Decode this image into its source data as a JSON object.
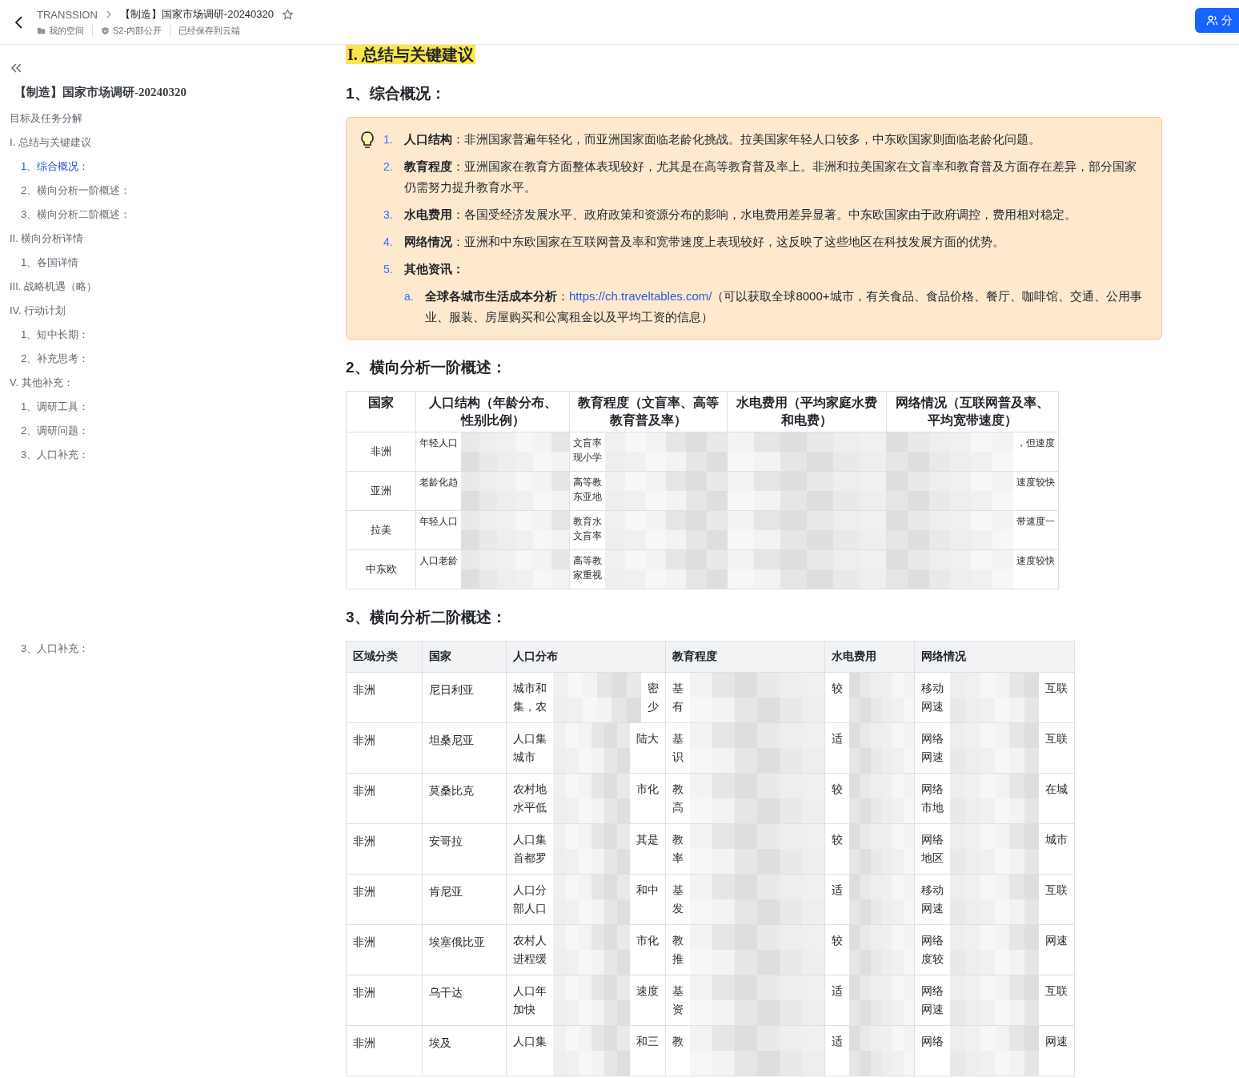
{
  "header": {
    "breadcrumb": "TRANSSION",
    "title": "【制造】国家市场调研-20240320",
    "starred": false,
    "meta": [
      {
        "kind": "folder",
        "text": "我的空间"
      },
      {
        "kind": "shield",
        "text": "S2-内部公开"
      },
      {
        "kind": "plain",
        "text": "已经保存到云端"
      }
    ],
    "share_button": "分"
  },
  "sidebar": {
    "title": "【制造】国家市场调研-20240320",
    "items": [
      {
        "label": "目标及任务分解",
        "selected": false
      },
      {
        "label": "I. 总结与关键建议",
        "selected": false,
        "children": [
          {
            "label": "1、综合概况：",
            "selected": true
          },
          {
            "label": "2、横向分析一阶概述：",
            "selected": false
          },
          {
            "label": "3、横向分析二阶概述：",
            "selected": false
          }
        ]
      },
      {
        "label": "II. 横向分析详情",
        "selected": false,
        "children": [
          {
            "label": "1、各国详情",
            "selected": false
          }
        ]
      },
      {
        "label": "III. 战略机遇（略）",
        "selected": false
      },
      {
        "label": "IV. 行动计划",
        "selected": false,
        "children": [
          {
            "label": "1、短中长期：",
            "selected": false
          },
          {
            "label": "2、补充思考：",
            "selected": false
          }
        ]
      },
      {
        "label": "V. 其他补充：",
        "selected": false,
        "children": [
          {
            "label": "1、调研工具：",
            "selected": false
          },
          {
            "label": "2、调研问题：",
            "selected": false
          },
          {
            "label": "3、人口补充：",
            "selected": false
          }
        ]
      }
    ],
    "trailing_text": "3、人口补充："
  },
  "document": {
    "section_title": "I. 总结与关键建议",
    "blocks": [
      {
        "kind": "heading",
        "text": "1、综合概况："
      },
      {
        "kind": "callout",
        "items": [
          {
            "marker": "1.",
            "term": "人口结构",
            "text": "：非洲国家普遍年轻化，而亚洲国家面临老龄化挑战。拉美国家年轻人口较多，中东欧国家则面临老龄化问题。"
          },
          {
            "marker": "2.",
            "term": "教育程度",
            "text": "：亚洲国家在教育方面整体表现较好，尤其是在高等教育普及率上。非洲和拉美国家在文盲率和教育普及方面存在差异，部分国家仍需努力提升教育水平。"
          },
          {
            "marker": "3.",
            "term": "水电费用",
            "text": "：各国受经济发展水平、政府政策和资源分布的影响，水电费用差异显著。中东欧国家由于政府调控，费用相对稳定。"
          },
          {
            "marker": "4.",
            "term": "网络情况",
            "text": "：亚洲和中东欧国家在互联网普及率和宽带速度上表现较好，这反映了这些地区在科技发展方面的优势。"
          },
          {
            "marker": "5.",
            "term": "其他资讯：",
            "children": [
              {
                "marker": "a.",
                "term": "全球各城市生活成本分析",
                "text": "：",
                "link": "https://ch.traveltables.com/",
                "after": "（可以获取全球8000+城市，有关食品、食品价格、餐厅、咖啡馆、交通、公用事业、服装、房屋购买和公寓租金以及平均工资的信息）"
              }
            ]
          }
        ]
      },
      {
        "kind": "heading",
        "text": "2、横向分析一阶概述："
      },
      {
        "kind": "summary_table",
        "columns": [
          "国家",
          "人口结构（年龄分布、性别比例）",
          "教育程度（文盲率、高等教育普及率）",
          "水电费用（平均家庭水费和电费）",
          "网络情况（互联网普及率、平均宽带速度）"
        ],
        "rows": [
          {
            "cells": [
              "非洲",
              {
                "left": [
                  "年轻人口"
                ],
                "redacted": true
              },
              {
                "left": [
                  "文盲率",
                  "现小学"
                ],
                "redacted": true
              },
              {
                "redacted": true
              },
              {
                "redacted": true,
                "right": [
                  "，但速度"
                ]
              }
            ]
          },
          {
            "cells": [
              "亚洲",
              {
                "left": [
                  "老龄化趋"
                ],
                "redacted": true
              },
              {
                "left": [
                  "高等教",
                  "东亚地"
                ],
                "redacted": true
              },
              {
                "redacted": true
              },
              {
                "redacted": true,
                "right": [
                  "速度较快"
                ]
              }
            ]
          },
          {
            "cells": [
              "拉美",
              {
                "left": [
                  "年轻人口"
                ],
                "redacted": true
              },
              {
                "left": [
                  "教育水",
                  "文盲率"
                ],
                "redacted": true
              },
              {
                "redacted": true
              },
              {
                "redacted": true,
                "right": [
                  "带速度一"
                ]
              }
            ]
          },
          {
            "cells": [
              "中东欧",
              {
                "left": [
                  "人口老龄"
                ],
                "redacted": true
              },
              {
                "left": [
                  "高等教",
                  "家重视"
                ],
                "redacted": true
              },
              {
                "redacted": true
              },
              {
                "redacted": true,
                "right": [
                  "速度较快"
                ]
              }
            ]
          }
        ]
      },
      {
        "kind": "heading",
        "text": "3、横向分析二阶概述："
      },
      {
        "kind": "detail_table",
        "columns": [
          "区域分类",
          "国家",
          "人口分布",
          "教育程度",
          "水电费用",
          "网络情况"
        ],
        "rows": [
          {
            "cells": [
              "非洲",
              "尼日利亚",
              {
                "left": [
                  "城市和",
                  "集，农"
                ],
                "redacted": true,
                "right": [
                  "密",
                  "少"
                ]
              },
              {
                "left": [
                  "基",
                  "有"
                ],
                "redacted": true
              },
              {
                "left": [
                  "较"
                ],
                "redacted": true
              },
              {
                "left": [
                  "移动",
                  "网速"
                ],
                "redacted": true,
                "right": [
                  "互联"
                ]
              }
            ]
          },
          {
            "cells": [
              "非洲",
              "坦桑尼亚",
              {
                "left": [
                  "人口集",
                  "城市"
                ],
                "redacted": true,
                "right": [
                  "陆大"
                ]
              },
              {
                "left": [
                  "基",
                  "识"
                ],
                "redacted": true
              },
              {
                "left": [
                  "适"
                ],
                "redacted": true
              },
              {
                "left": [
                  "网络",
                  "网速"
                ],
                "redacted": true,
                "right": [
                  "互联"
                ]
              }
            ]
          },
          {
            "cells": [
              "非洲",
              "莫桑比克",
              {
                "left": [
                  "农村地",
                  "水平低"
                ],
                "redacted": true,
                "right": [
                  "市化"
                ]
              },
              {
                "left": [
                  "教",
                  "高"
                ],
                "redacted": true
              },
              {
                "left": [
                  "较"
                ],
                "redacted": true
              },
              {
                "left": [
                  "网络",
                  "市地"
                ],
                "redacted": true,
                "right": [
                  "在城"
                ]
              }
            ]
          },
          {
            "cells": [
              "非洲",
              "安哥拉",
              {
                "left": [
                  "人口集",
                  "首都罗"
                ],
                "redacted": true,
                "right": [
                  "其是"
                ]
              },
              {
                "left": [
                  "教",
                  "率"
                ],
                "redacted": true
              },
              {
                "left": [
                  "较"
                ],
                "redacted": true
              },
              {
                "left": [
                  "网络",
                  "地区"
                ],
                "redacted": true,
                "right": [
                  "城市"
                ]
              }
            ]
          },
          {
            "cells": [
              "非洲",
              "肯尼亚",
              {
                "left": [
                  "人口分",
                  "部人口"
                ],
                "redacted": true,
                "right": [
                  "和中"
                ]
              },
              {
                "left": [
                  "基",
                  "发"
                ],
                "redacted": true
              },
              {
                "left": [
                  "适"
                ],
                "redacted": true
              },
              {
                "left": [
                  "移动",
                  "网速"
                ],
                "redacted": true,
                "right": [
                  "互联"
                ]
              }
            ]
          },
          {
            "cells": [
              "非洲",
              "埃塞俄比亚",
              {
                "left": [
                  "农村人",
                  "进程缓"
                ],
                "redacted": true,
                "right": [
                  "市化"
                ]
              },
              {
                "left": [
                  "教",
                  "推"
                ],
                "redacted": true
              },
              {
                "left": [
                  "较"
                ],
                "redacted": true
              },
              {
                "left": [
                  "网络",
                  "度较"
                ],
                "redacted": true,
                "right": [
                  "网速"
                ]
              }
            ]
          },
          {
            "cells": [
              "非洲",
              "乌干达",
              {
                "left": [
                  "人口年",
                  "加快"
                ],
                "redacted": true,
                "right": [
                  "速度"
                ]
              },
              {
                "left": [
                  "基",
                  "资"
                ],
                "redacted": true
              },
              {
                "left": [
                  "适"
                ],
                "redacted": true
              },
              {
                "left": [
                  "网络",
                  "网速"
                ],
                "redacted": true,
                "right": [
                  "互联"
                ]
              }
            ]
          },
          {
            "cells": [
              "非洲",
              "埃及",
              {
                "left": [
                  "人口集"
                ],
                "redacted": true,
                "right": [
                  "和三"
                ]
              },
              {
                "left": [
                  "教"
                ],
                "redacted": true
              },
              {
                "left": [
                  "适"
                ],
                "redacted": true
              },
              {
                "left": [
                  "网络"
                ],
                "redacted": true,
                "right": [
                  "网速"
                ]
              }
            ]
          }
        ]
      }
    ]
  }
}
